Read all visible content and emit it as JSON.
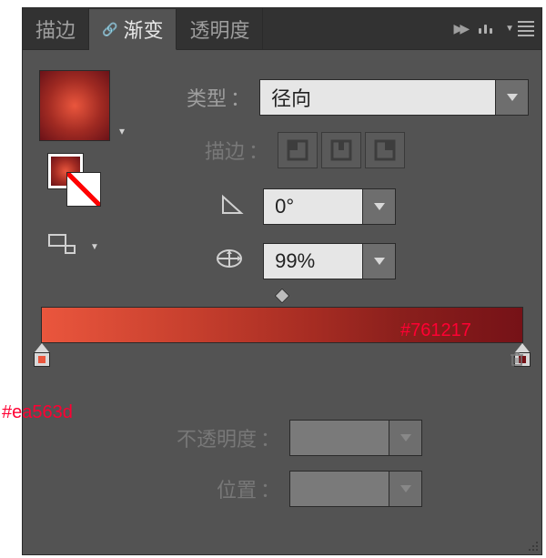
{
  "tabs": {
    "stroke": "描边",
    "gradient": "渐变",
    "transparency": "透明度"
  },
  "labels": {
    "type": "类型",
    "stroke": "描边",
    "opacity": "不透明度",
    "location": "位置",
    "colon": "："
  },
  "values": {
    "type_selected": "径向",
    "angle": "0°",
    "aspect": "99%"
  },
  "gradient": {
    "left_hex": "#ea563d",
    "right_hex": "#761217"
  },
  "annotations": {
    "right": "#761217",
    "left": "#ea563d"
  }
}
